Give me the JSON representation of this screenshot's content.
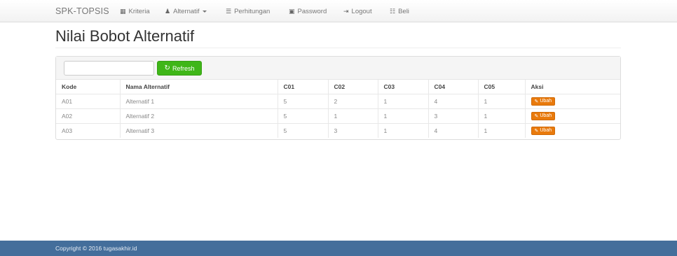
{
  "navbar": {
    "brand": "SPK-TOPSIS",
    "items": [
      {
        "label": "Kriteria",
        "icon": "th-large-icon"
      },
      {
        "label": "Alternatif",
        "icon": "user-icon"
      },
      {
        "label": "Perhitungan",
        "icon": "list-icon"
      },
      {
        "label": "Password",
        "icon": "lock-icon"
      },
      {
        "label": "Logout",
        "icon": "log-out-icon"
      },
      {
        "label": "Beli",
        "icon": "cart-icon"
      }
    ]
  },
  "page": {
    "title": "Nilai Bobot Alternatif"
  },
  "toolbar": {
    "search_value": "",
    "search_placeholder": "",
    "refresh_label": "Refresh"
  },
  "table": {
    "headers": [
      "Kode",
      "Nama Alternatif",
      "C01",
      "C02",
      "C03",
      "C04",
      "C05",
      "Aksi"
    ],
    "rows": [
      {
        "kode": "A01",
        "nama": "Alternatif 1",
        "c01": "5",
        "c02": "2",
        "c03": "1",
        "c04": "4",
        "c05": "1",
        "aksi": "Ubah"
      },
      {
        "kode": "A02",
        "nama": "Alternatif 2",
        "c01": "5",
        "c02": "1",
        "c03": "1",
        "c04": "3",
        "c05": "1",
        "aksi": "Ubah"
      },
      {
        "kode": "A03",
        "nama": "Alternatif 3",
        "c01": "5",
        "c02": "3",
        "c03": "1",
        "c04": "4",
        "c05": "1",
        "aksi": "Ubah"
      }
    ]
  },
  "footer": {
    "text": "Copyright © 2016 tugasakhir.id"
  },
  "colors": {
    "primary": "#446e9b",
    "success": "#3fb618",
    "warning": "#e97a0c"
  }
}
